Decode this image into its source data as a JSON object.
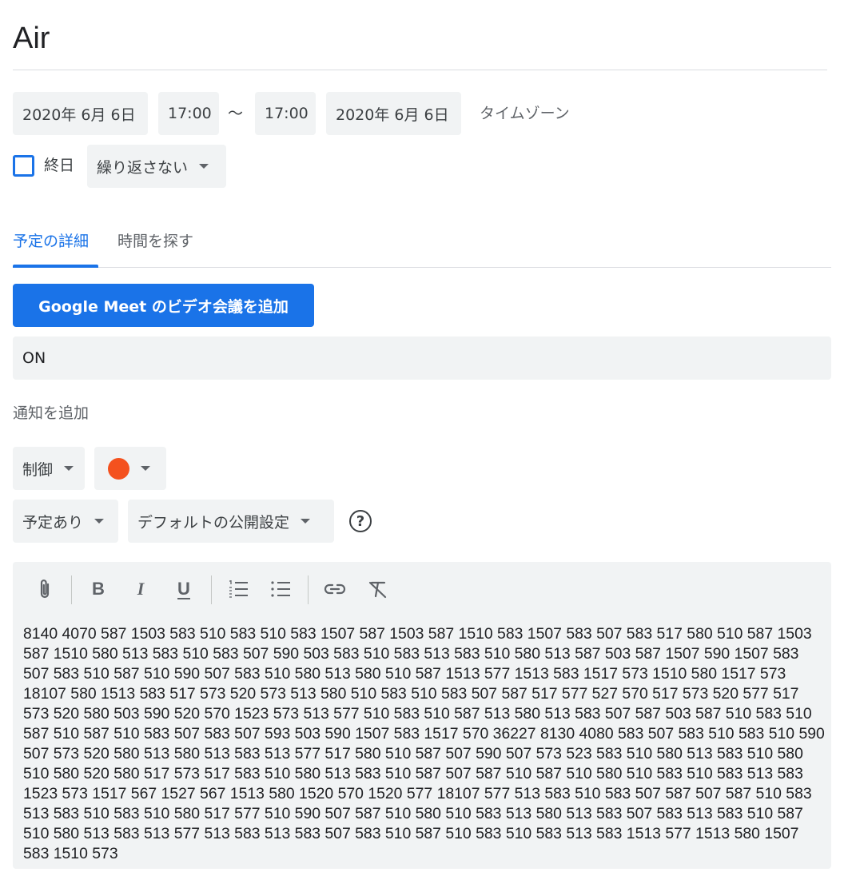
{
  "event": {
    "title": "Air"
  },
  "datetime": {
    "start_date": "2020年 6月 6日",
    "start_time": "17:00",
    "separator": "〜",
    "end_time": "17:00",
    "end_date": "2020年 6月 6日",
    "timezone_label": "タイムゾーン"
  },
  "options": {
    "all_day_label": "終日",
    "all_day_checked": false,
    "repeat_value": "繰り返さない"
  },
  "tabs": [
    {
      "label": "予定の詳細",
      "active": true
    },
    {
      "label": "時間を探す",
      "active": false
    }
  ],
  "meet": {
    "button_label": "Google Meet のビデオ会議を追加"
  },
  "location": {
    "value": "ON"
  },
  "notification": {
    "add_label": "通知を追加"
  },
  "calendar": {
    "name": "制御",
    "color": "#f4511e"
  },
  "availability": {
    "value": "予定あり"
  },
  "visibility": {
    "value": "デフォルトの公開設定",
    "help_glyph": "?"
  },
  "description": {
    "toolbar": {
      "attach_icon": "paperclip-icon",
      "bold_glyph": "B",
      "italic_glyph": "I",
      "underline_glyph": "U",
      "numbered_list_icon": "numbered-list-icon",
      "bulleted_list_icon": "bulleted-list-icon",
      "link_icon": "link-icon",
      "clear_format_icon": "clear-formatting-icon"
    },
    "text": "8140 4070 587 1503 583 510 583 510 583 1507 587 1503 587 1510 583 1507 583 507 583 517 580 510 587 1503 587 1510 580 513 583 510 583 507 590 503 583 510 583 513 583 510 580 513 587 503 587 1507 590 1507 583 507 583 510 587 510 590 507 583 510 580 513 580 510 587 1513 577 1513 583 1517 573 1510 580 1517 573 18107 580 1513 583 517 573 520 573 513 580 510 583 510 583 507 587 517 577 527 570 517 573 520 577 517 573 520 580 503 590 520 570 1523 573 513 577 510 583 510 587 513 580 513 583 507 587 503 587 510 583 510 587 510 587 510 583 507 583 507 593 503 590 1507 583 1517 570 36227 8130 4080 583 507 583 510 583 510 590 507 573 520 580 513 580 513 583 513 577 517 580 510 587 507 590 507 573 523 583 510 580 513 583 510 580 510 580 520 580 517 573 517 583 510 580 513 583 510 587 507 587 510 587 510 580 510 583 510 583 513 583 1523 573 1517 567 1527 567 1513 580 1520 570 1520 577 18107 577 513 583 510 583 507 587 507 587 510 583 513 583 510 583 510 580 517 577 510 590 507 587 510 580 510 583 513 580 513 583 507 583 513 583 510 587 510 580 513 583 513 577 513 583 513 583 507 583 510 587 510 583 510 583 513 583 1513 577 1513 580 1507 583 1510 573"
  }
}
